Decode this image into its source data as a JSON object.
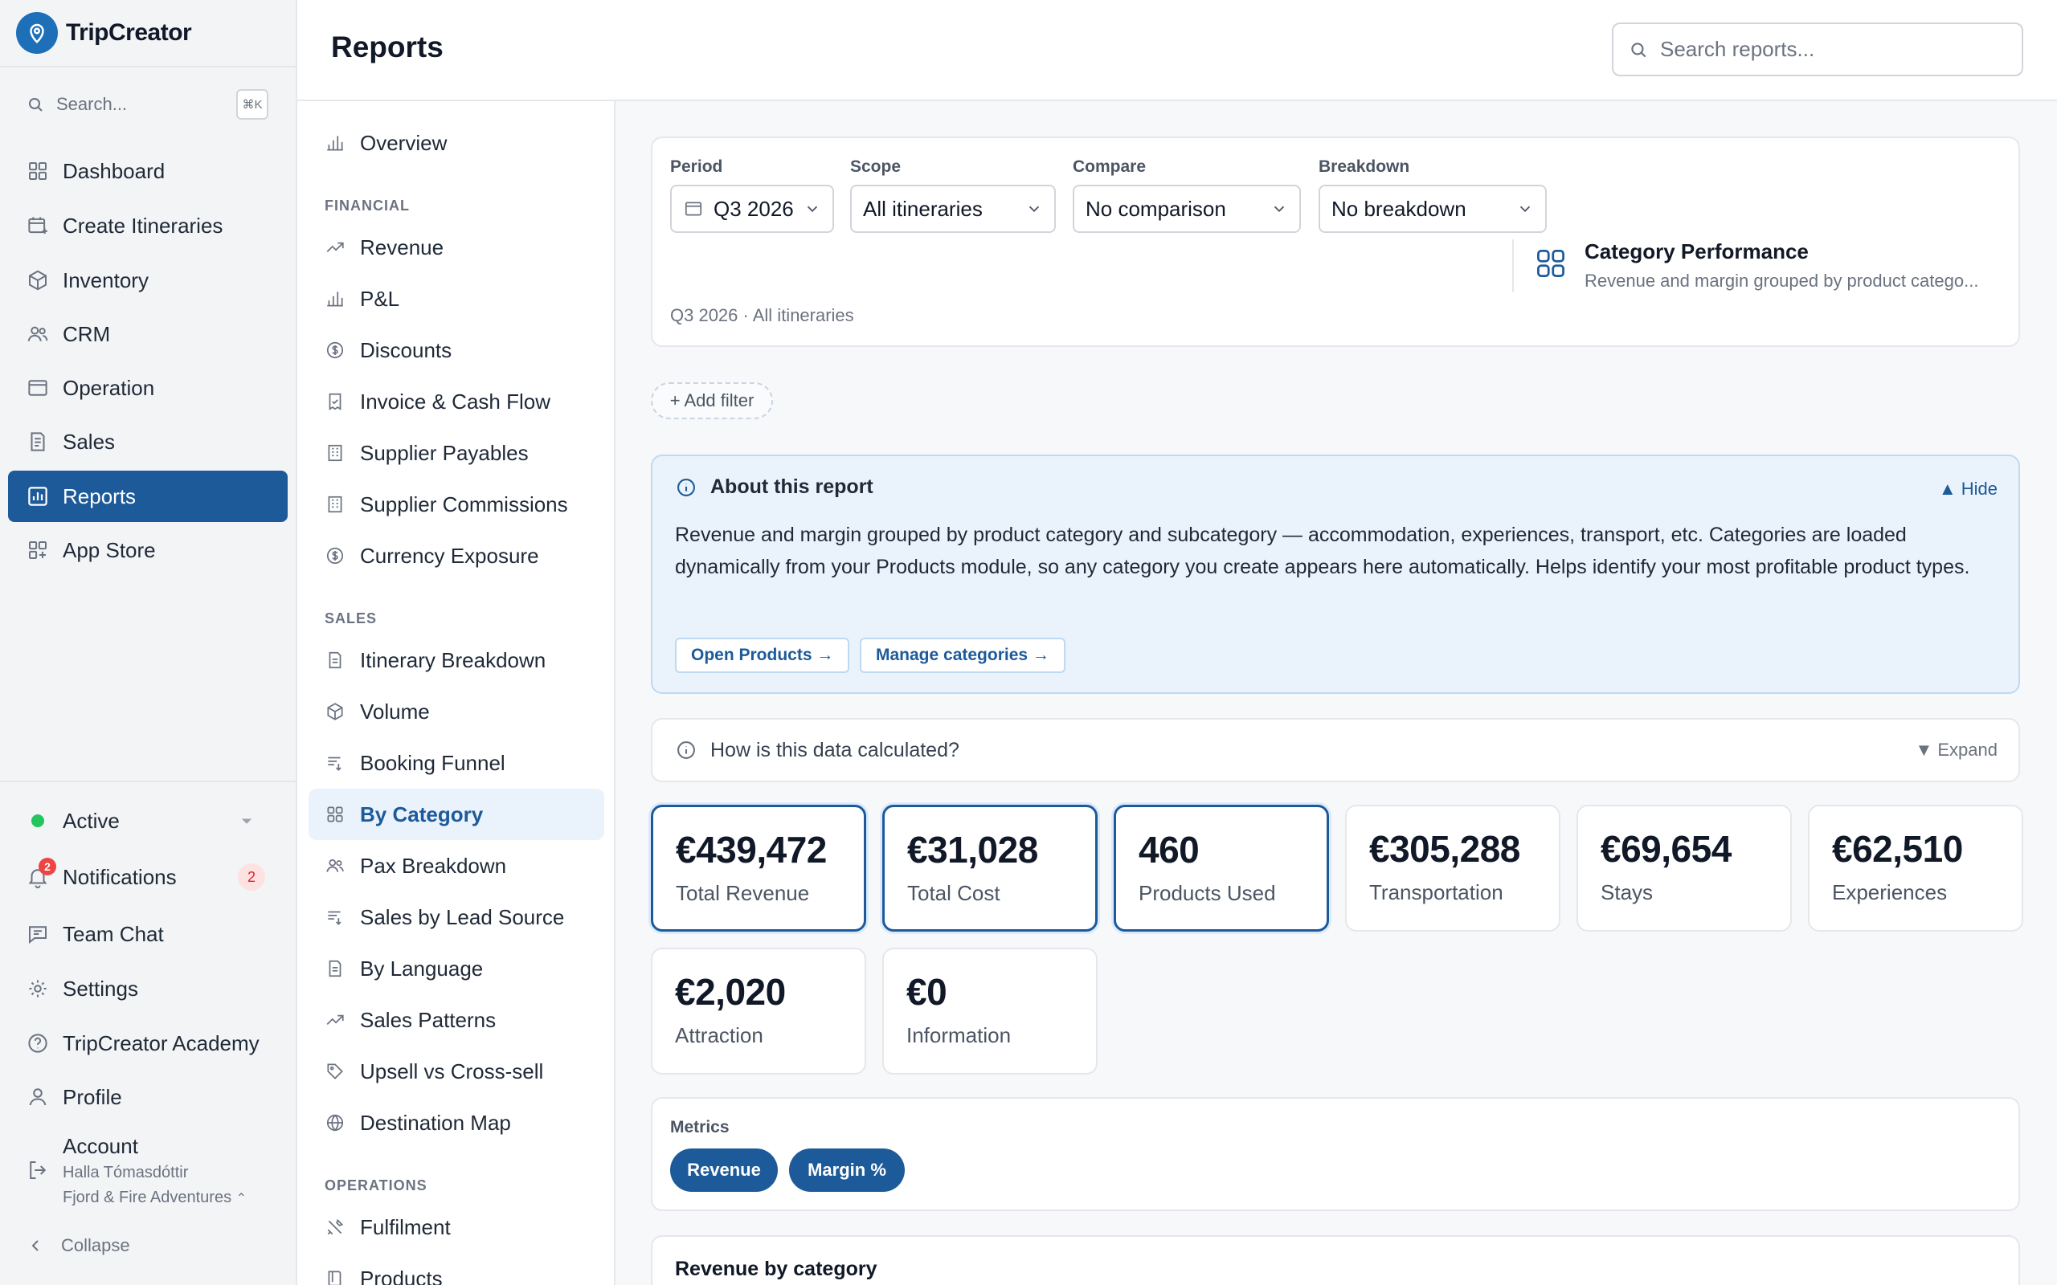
{
  "app": {
    "name": "TripCreator"
  },
  "sidebar": {
    "search_placeholder": "Search...",
    "search_shortcut": "⌘K",
    "items": [
      {
        "label": "Dashboard",
        "icon": "grid-icon"
      },
      {
        "label": "Create Itineraries",
        "icon": "calendar-plus-icon"
      },
      {
        "label": "Inventory",
        "icon": "box-icon"
      },
      {
        "label": "CRM",
        "icon": "users-icon"
      },
      {
        "label": "Operation",
        "icon": "calendar-icon"
      },
      {
        "label": "Sales",
        "icon": "document-icon"
      },
      {
        "label": "Reports",
        "icon": "chart-icon",
        "active": true
      },
      {
        "label": "App Store",
        "icon": "grid-plus-icon"
      }
    ],
    "status": "Active",
    "notifications_label": "Notifications",
    "notifications_count": "2",
    "team_chat": "Team Chat",
    "settings": "Settings",
    "academy": "TripCreator Academy",
    "profile": "Profile",
    "account": {
      "label": "Account",
      "user": "Halla Tómasdóttir",
      "company": "Fjord & Fire Adventures"
    },
    "collapse": "Collapse"
  },
  "header": {
    "title": "Reports",
    "search_placeholder": "Search reports..."
  },
  "report_nav": {
    "overview": "Overview",
    "financial_heading": "FINANCIAL",
    "financial": [
      "Revenue",
      "P&L",
      "Discounts",
      "Invoice & Cash Flow",
      "Supplier Payables",
      "Supplier Commissions",
      "Currency Exposure"
    ],
    "sales_heading": "SALES",
    "sales": [
      "Itinerary Breakdown",
      "Volume",
      "Booking Funnel",
      "By Category",
      "Pax Breakdown",
      "Sales by Lead Source",
      "By Language",
      "Sales Patterns",
      "Upsell vs Cross-sell",
      "Destination Map"
    ],
    "sales_active": "By Category",
    "operations_heading": "OPERATIONS",
    "operations": [
      "Fulfilment",
      "Products"
    ]
  },
  "filters": {
    "period": {
      "label": "Period",
      "value": "Q3 2026"
    },
    "scope": {
      "label": "Scope",
      "value": "All itineraries"
    },
    "compare": {
      "label": "Compare",
      "value": "No comparison"
    },
    "breakdown": {
      "label": "Breakdown",
      "value": "No breakdown"
    },
    "summary": "Q3 2026 · All itineraries",
    "add_filter": "+ Add filter"
  },
  "report": {
    "name": "Category Performance",
    "description": "Revenue and margin grouped by product catego..."
  },
  "about": {
    "title": "About this report",
    "hide": "▲ Hide",
    "body": "Revenue and margin grouped by product category and subcategory — accommodation, experiences, transport, etc. Categories are loaded dynamically from your Products module, so any category you create appears here automatically. Helps identify your most profitable product types.",
    "open_products": "Open Products →",
    "manage_categories": "Manage categories →"
  },
  "calc": {
    "title": "How is this data calculated?",
    "expand": "▼ Expand"
  },
  "kpis": [
    {
      "value": "€439,472",
      "label": "Total Revenue",
      "selected": true
    },
    {
      "value": "€31,028",
      "label": "Total Cost",
      "selected": true
    },
    {
      "value": "460",
      "label": "Products Used",
      "selected": true
    },
    {
      "value": "€305,288",
      "label": "Transportation",
      "selected": false
    },
    {
      "value": "€69,654",
      "label": "Stays",
      "selected": false
    },
    {
      "value": "€62,510",
      "label": "Experiences",
      "selected": false
    },
    {
      "value": "€2,020",
      "label": "Attraction",
      "selected": false
    },
    {
      "value": "€0",
      "label": "Information",
      "selected": false
    }
  ],
  "metrics": {
    "label": "Metrics",
    "pills": [
      "Revenue",
      "Margin %"
    ]
  },
  "chart_section": {
    "title": "Revenue by category"
  },
  "colors": {
    "accent": "#1d5a99",
    "brand": "#1d6fb8",
    "active_bg": "#eaf2fb",
    "info_bg": "#eaf3fc"
  }
}
